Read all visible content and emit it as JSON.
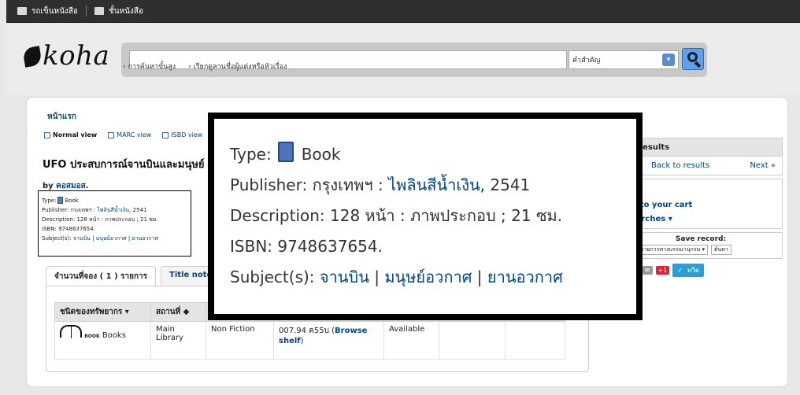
{
  "topbar": {
    "cart": "รถเข็นหนังสือ",
    "shelves": "ชั้นหนังสือ"
  },
  "logo": "koha",
  "search": {
    "value": "",
    "index_selected": "คำสำคัญ"
  },
  "header_links": [
    "การค้นหาขั้นสูง",
    "เรียกดูลานชื่อผู้แต่งหรือหัวเรื่อง"
  ],
  "breadcrumb": "หน้าแรก",
  "views": {
    "normal": "Normal view",
    "marc": "MARC view",
    "isbd": "ISBD view"
  },
  "record": {
    "title": "UFO ประสบการณ์จานบินและมนุษย์",
    "byline_prefix": "by",
    "author": "คอสมอส",
    "type_label": "Type:",
    "type_value": "Book",
    "publisher_label": "Publisher:",
    "publisher_place": "กรุงเทพฯ :",
    "publisher_name": "ไพลินสีน้ำเงิน,",
    "publisher_year": "2541",
    "description_label": "Description:",
    "description_value": "128 หน้า : ภาพประกอบ ; 21 ซม.",
    "isbn_label": "ISBN:",
    "isbn_value": "9748637654.",
    "subjects_label": "Subject(s):",
    "subjects": [
      "จานบิน",
      "มนุษย์อวกาศ",
      "ยานอวกาศ"
    ],
    "subject_sep": "|"
  },
  "tabs": {
    "holdings": "จำนวนที่จอง ( 1 ) รายการ",
    "title_notes": "Title notes"
  },
  "holdings": {
    "headers": [
      "ชนิดของทรัพยากร",
      "สถานที่"
    ],
    "row": {
      "type_icon_label": "BOOK",
      "type": "Books",
      "location": "Main Library",
      "collection": "Non Fiction",
      "call_number": "007.94 ค55บ",
      "browse": "Browse shelf",
      "status": "Available"
    }
  },
  "sidebar": {
    "browse_results": "se results",
    "back": "Back to results",
    "next": "Next »",
    "heading": "มท์",
    "add_cart": "dd to your cart",
    "more_searches": "searches",
    "save_record": "Save record:",
    "save_format": "แสดงรายการทางบรรณานุกรม",
    "save_go": "ต้นหา",
    "share_tweet": "ทวีต"
  }
}
